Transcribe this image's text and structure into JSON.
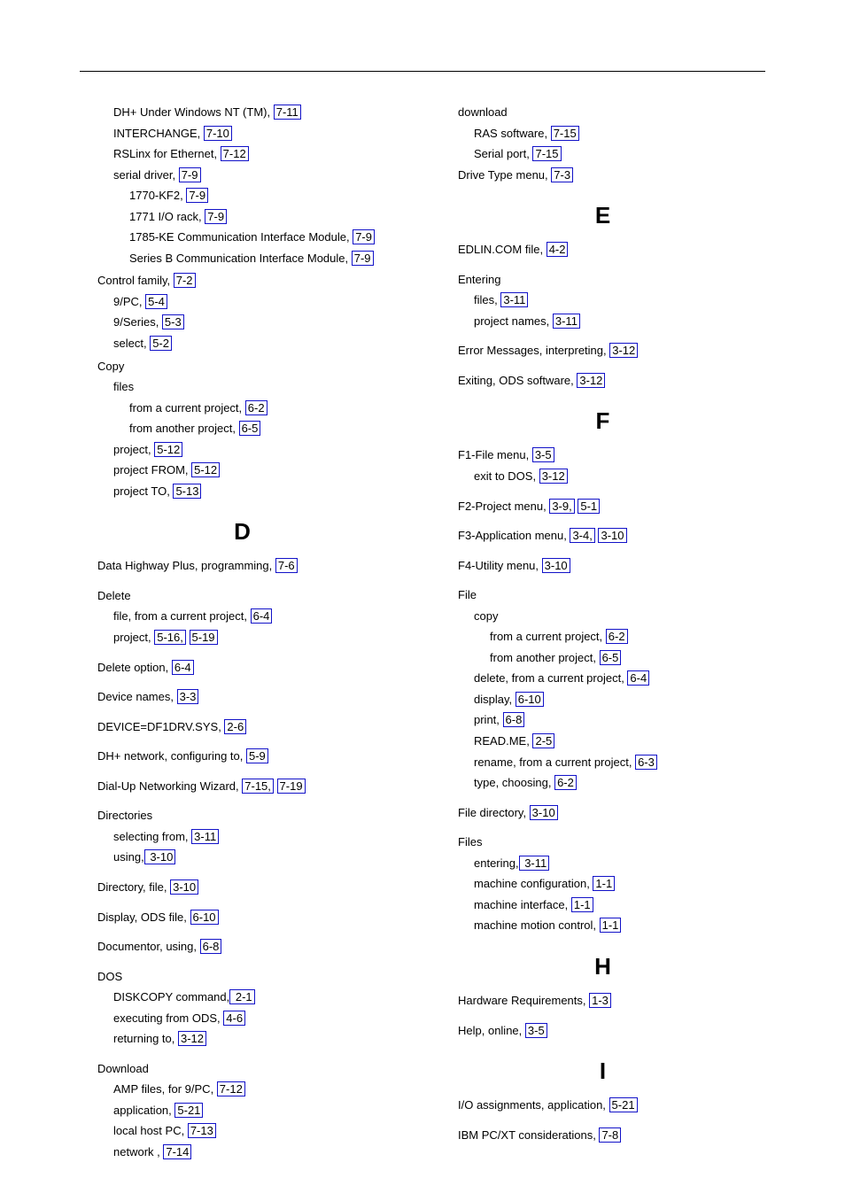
{
  "col1_pre": [
    {
      "indent": 1,
      "parts": [
        {
          "t": "DH+ Under Windows NT (TM), "
        },
        {
          "r": "7-11"
        }
      ]
    },
    {
      "indent": 1,
      "parts": [
        {
          "t": "INTERCHANGE, "
        },
        {
          "r": "7-10"
        }
      ]
    },
    {
      "indent": 1,
      "parts": [
        {
          "t": "RSLinx for Ethernet, "
        },
        {
          "r": "7-12"
        }
      ]
    },
    {
      "indent": 1,
      "parts": [
        {
          "t": "serial driver, "
        },
        {
          "r": "7-9"
        }
      ]
    },
    {
      "indent": 2,
      "parts": [
        {
          "t": "1770-KF2, "
        },
        {
          "r": "7-9"
        }
      ]
    },
    {
      "indent": 2,
      "parts": [
        {
          "t": "1771 I/O rack, "
        },
        {
          "r": "7-9"
        }
      ]
    },
    {
      "indent": 2,
      "parts": [
        {
          "t": "1785-KE Communication Interface Module, "
        },
        {
          "r": "7-9"
        }
      ]
    },
    {
      "indent": 2,
      "parts": [
        {
          "t": "Series B Communication Interface Module, "
        },
        {
          "r": "7-9"
        }
      ]
    }
  ],
  "col1_entries": {
    "control_family": [
      {
        "indent": 0,
        "parts": [
          {
            "t": "Control family, "
          },
          {
            "r": "7-2"
          }
        ]
      },
      {
        "indent": 1,
        "parts": [
          {
            "t": "9/PC, "
          },
          {
            "r": "5-4"
          }
        ]
      },
      {
        "indent": 1,
        "parts": [
          {
            "t": "9/Series, "
          },
          {
            "r": "5-3"
          }
        ]
      },
      {
        "indent": 1,
        "parts": [
          {
            "t": "select, "
          },
          {
            "r": "5-2"
          }
        ]
      }
    ],
    "copy": [
      {
        "indent": 0,
        "parts": [
          {
            "t": "Copy"
          }
        ]
      },
      {
        "indent": 1,
        "parts": [
          {
            "t": "files"
          }
        ]
      },
      {
        "indent": 2,
        "parts": [
          {
            "t": "from a current project, "
          },
          {
            "r": "6-2"
          }
        ]
      },
      {
        "indent": 2,
        "parts": [
          {
            "t": "from another project, "
          },
          {
            "r": "6-5"
          }
        ]
      },
      {
        "indent": 1,
        "parts": [
          {
            "t": "project, "
          },
          {
            "r": "5-12"
          }
        ]
      },
      {
        "indent": 1,
        "parts": [
          {
            "t": "project FROM, "
          },
          {
            "r": "5-12"
          }
        ]
      },
      {
        "indent": 1,
        "parts": [
          {
            "t": "project TO, "
          },
          {
            "r": "5-13"
          }
        ]
      }
    ]
  },
  "letter_D": "D",
  "col1_D": [
    {
      "indent": 0,
      "parts": [
        {
          "t": "Data Highway Plus, programming, "
        },
        {
          "r": "7-6"
        }
      ]
    },
    {
      "indent": 0,
      "spacer": true
    },
    {
      "indent": 0,
      "parts": [
        {
          "t": "Delete"
        }
      ]
    },
    {
      "indent": 1,
      "parts": [
        {
          "t": "file, from a current project, "
        },
        {
          "r": "6-4"
        }
      ]
    },
    {
      "indent": 1,
      "parts": [
        {
          "t": "project, "
        },
        {
          "r": "5-16,"
        },
        {
          "t": " "
        },
        {
          "r": "5-19"
        }
      ]
    },
    {
      "indent": 0,
      "spacer": true
    },
    {
      "indent": 0,
      "parts": [
        {
          "t": "Delete option, "
        },
        {
          "r": "6-4"
        }
      ]
    },
    {
      "indent": 0,
      "spacer": true
    },
    {
      "indent": 0,
      "parts": [
        {
          "t": "Device names, "
        },
        {
          "r": "3-3"
        }
      ]
    },
    {
      "indent": 0,
      "spacer": true
    },
    {
      "indent": 0,
      "parts": [
        {
          "t": "DEVICE=DF1DRV.SYS, "
        },
        {
          "r": "2-6"
        }
      ]
    },
    {
      "indent": 0,
      "spacer": true
    },
    {
      "indent": 0,
      "parts": [
        {
          "t": "DH+ network, configuring to, "
        },
        {
          "r": "5-9"
        }
      ]
    },
    {
      "indent": 0,
      "spacer": true
    },
    {
      "indent": 0,
      "parts": [
        {
          "t": "Dial-Up Networking Wizard, "
        },
        {
          "r": "7-15,"
        },
        {
          "t": " "
        },
        {
          "r": "7-19"
        }
      ]
    },
    {
      "indent": 0,
      "spacer": true
    },
    {
      "indent": 0,
      "parts": [
        {
          "t": "Directories"
        }
      ]
    },
    {
      "indent": 1,
      "parts": [
        {
          "t": "selecting from, "
        },
        {
          "r": "3-11"
        }
      ]
    },
    {
      "indent": 1,
      "parts": [
        {
          "t": "using,"
        },
        {
          "r": " 3-10"
        }
      ]
    },
    {
      "indent": 0,
      "spacer": true
    },
    {
      "indent": 0,
      "parts": [
        {
          "t": "Directory, file, "
        },
        {
          "r": "3-10"
        }
      ]
    },
    {
      "indent": 0,
      "spacer": true
    },
    {
      "indent": 0,
      "parts": [
        {
          "t": "Display, ODS file, "
        },
        {
          "r": "6-10"
        }
      ]
    },
    {
      "indent": 0,
      "spacer": true
    },
    {
      "indent": 0,
      "parts": [
        {
          "t": "Documentor, using, "
        },
        {
          "r": "6-8"
        }
      ]
    },
    {
      "indent": 0,
      "spacer": true
    },
    {
      "indent": 0,
      "parts": [
        {
          "t": "DOS"
        }
      ]
    },
    {
      "indent": 1,
      "parts": [
        {
          "t": "DISKCOPY command,"
        },
        {
          "r": " 2-1"
        }
      ]
    },
    {
      "indent": 1,
      "parts": [
        {
          "t": "executing from ODS, "
        },
        {
          "r": "4-6"
        }
      ]
    },
    {
      "indent": 1,
      "parts": [
        {
          "t": "returning to, "
        },
        {
          "r": "3-12"
        }
      ]
    },
    {
      "indent": 0,
      "spacer": true
    },
    {
      "indent": 0,
      "parts": [
        {
          "t": "Download"
        }
      ]
    },
    {
      "indent": 1,
      "parts": [
        {
          "t": "AMP files, for 9/PC, "
        },
        {
          "r": "7-12"
        }
      ]
    },
    {
      "indent": 1,
      "parts": [
        {
          "t": "application, "
        },
        {
          "r": "5-21"
        }
      ]
    },
    {
      "indent": 1,
      "parts": [
        {
          "t": "local host PC, "
        },
        {
          "r": "7-13"
        }
      ]
    },
    {
      "indent": 1,
      "parts": [
        {
          "t": "network , "
        },
        {
          "r": "7-14"
        }
      ]
    }
  ],
  "col2_pre": [
    {
      "indent": 0,
      "parts": [
        {
          "t": "download"
        }
      ]
    },
    {
      "indent": 1,
      "parts": [
        {
          "t": "RAS software, "
        },
        {
          "r": "7-15"
        }
      ]
    },
    {
      "indent": 1,
      "parts": [
        {
          "t": "Serial port, "
        },
        {
          "r": "7-15"
        }
      ]
    },
    {
      "indent": 0,
      "parts": [
        {
          "t": "Drive Type menu, "
        },
        {
          "r": "7-3"
        }
      ]
    }
  ],
  "letter_E": "E",
  "col2_E": [
    {
      "indent": 0,
      "parts": [
        {
          "t": "EDLIN.COM file, "
        },
        {
          "r": "4-2"
        }
      ]
    },
    {
      "indent": 0,
      "spacer": true
    },
    {
      "indent": 0,
      "parts": [
        {
          "t": "Entering"
        }
      ]
    },
    {
      "indent": 1,
      "parts": [
        {
          "t": "files, "
        },
        {
          "r": "3-11"
        }
      ]
    },
    {
      "indent": 1,
      "parts": [
        {
          "t": "project names, "
        },
        {
          "r": "3-11"
        }
      ]
    },
    {
      "indent": 0,
      "spacer": true
    },
    {
      "indent": 0,
      "parts": [
        {
          "t": "Error Messages, interpreting, "
        },
        {
          "r": "3-12"
        }
      ]
    },
    {
      "indent": 0,
      "spacer": true
    },
    {
      "indent": 0,
      "parts": [
        {
          "t": "Exiting, ODS software, "
        },
        {
          "r": "3-12"
        }
      ]
    }
  ],
  "letter_F": "F",
  "col2_F": [
    {
      "indent": 0,
      "parts": [
        {
          "t": "F1-File menu, "
        },
        {
          "r": "3-5"
        }
      ]
    },
    {
      "indent": 1,
      "parts": [
        {
          "t": "exit to DOS, "
        },
        {
          "r": "3-12"
        }
      ]
    },
    {
      "indent": 0,
      "spacer": true
    },
    {
      "indent": 0,
      "parts": [
        {
          "t": "F2-Project menu, "
        },
        {
          "r": "3-9,"
        },
        {
          "t": " "
        },
        {
          "r": "5-1"
        }
      ]
    },
    {
      "indent": 0,
      "spacer": true
    },
    {
      "indent": 0,
      "parts": [
        {
          "t": "F3-Application menu, "
        },
        {
          "r": "3-4,"
        },
        {
          "t": " "
        },
        {
          "r": "3-10"
        }
      ]
    },
    {
      "indent": 0,
      "spacer": true
    },
    {
      "indent": 0,
      "parts": [
        {
          "t": "F4-Utility menu, "
        },
        {
          "r": "3-10"
        }
      ]
    },
    {
      "indent": 0,
      "spacer": true
    },
    {
      "indent": 0,
      "parts": [
        {
          "t": "File"
        }
      ]
    },
    {
      "indent": 1,
      "parts": [
        {
          "t": "copy"
        }
      ]
    },
    {
      "indent": 2,
      "parts": [
        {
          "t": "from a current project, "
        },
        {
          "r": "6-2"
        }
      ]
    },
    {
      "indent": 2,
      "parts": [
        {
          "t": "from another project, "
        },
        {
          "r": "6-5"
        }
      ]
    },
    {
      "indent": 1,
      "parts": [
        {
          "t": "delete, from a current project, "
        },
        {
          "r": "6-4"
        }
      ]
    },
    {
      "indent": 1,
      "parts": [
        {
          "t": "display, "
        },
        {
          "r": "6-10"
        }
      ]
    },
    {
      "indent": 1,
      "parts": [
        {
          "t": "print, "
        },
        {
          "r": "6-8"
        }
      ]
    },
    {
      "indent": 1,
      "parts": [
        {
          "t": "READ.ME, "
        },
        {
          "r": "2-5"
        }
      ]
    },
    {
      "indent": 1,
      "parts": [
        {
          "t": "rename, from a current project, "
        },
        {
          "r": "6-3"
        }
      ]
    },
    {
      "indent": 1,
      "parts": [
        {
          "t": "type, choosing, "
        },
        {
          "r": "6-2"
        }
      ]
    },
    {
      "indent": 0,
      "spacer": true
    },
    {
      "indent": 0,
      "parts": [
        {
          "t": "File directory, "
        },
        {
          "r": "3-10"
        }
      ]
    },
    {
      "indent": 0,
      "spacer": true
    },
    {
      "indent": 0,
      "parts": [
        {
          "t": "Files"
        }
      ]
    },
    {
      "indent": 1,
      "parts": [
        {
          "t": "entering,"
        },
        {
          "r": " 3-11"
        }
      ]
    },
    {
      "indent": 1,
      "parts": [
        {
          "t": "machine configuration, "
        },
        {
          "r": "1-1"
        }
      ]
    },
    {
      "indent": 1,
      "parts": [
        {
          "t": "machine interface, "
        },
        {
          "r": "1-1"
        }
      ]
    },
    {
      "indent": 1,
      "parts": [
        {
          "t": "machine motion control, "
        },
        {
          "r": "1-1"
        }
      ]
    }
  ],
  "letter_H": "H",
  "col2_H": [
    {
      "indent": 0,
      "parts": [
        {
          "t": "Hardware Requirements, "
        },
        {
          "r": "1-3"
        }
      ]
    },
    {
      "indent": 0,
      "spacer": true
    },
    {
      "indent": 0,
      "parts": [
        {
          "t": "Help, online, "
        },
        {
          "r": "3-5"
        }
      ]
    }
  ],
  "letter_I": "I",
  "col2_I": [
    {
      "indent": 0,
      "parts": [
        {
          "t": "I/O assignments, application, "
        },
        {
          "r": "5-21"
        }
      ]
    },
    {
      "indent": 0,
      "spacer": true
    },
    {
      "indent": 0,
      "parts": [
        {
          "t": "IBM PC/XT considerations, "
        },
        {
          "r": "7-8"
        }
      ]
    }
  ]
}
